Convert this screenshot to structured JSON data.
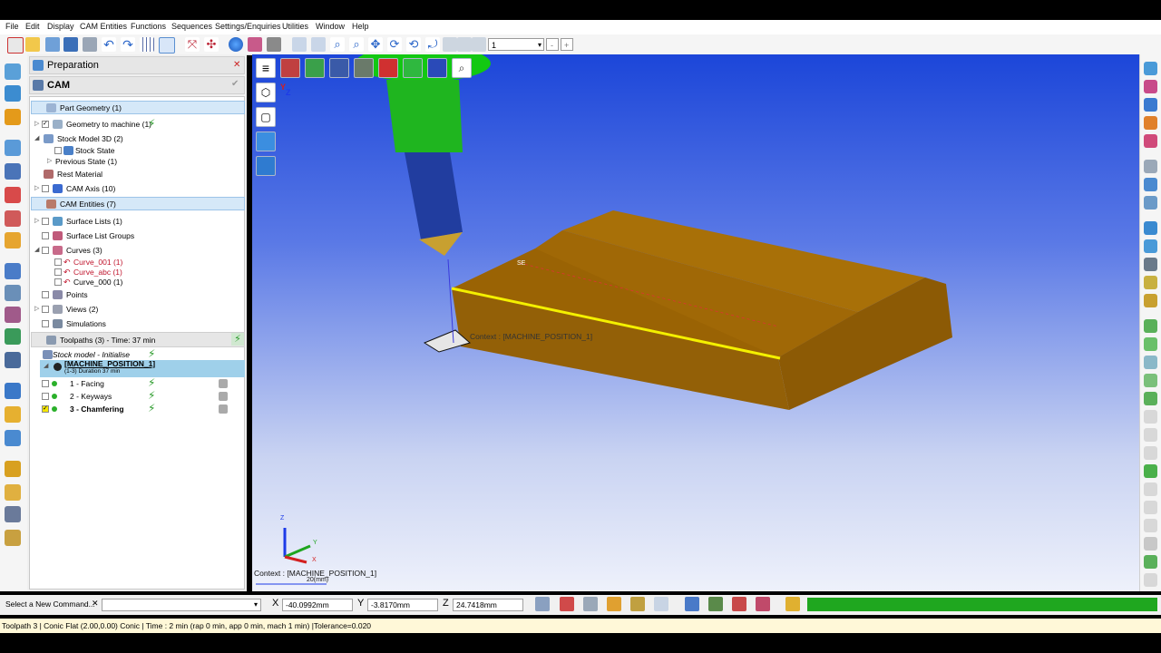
{
  "menu": [
    "File",
    "Edit",
    "Display",
    "CAM Entities",
    "Functions",
    "Sequences",
    "Settings/Enquiries",
    "Utilities",
    "Window",
    "Help"
  ],
  "toolbar": {
    "layer_value": "1",
    "minus": "-",
    "plus": "+"
  },
  "panel": {
    "title": "Preparation",
    "close": "✕",
    "section": "CAM",
    "tree": {
      "part_geometry": "Part Geometry (1)",
      "geometry_to_machine": "Geometry to machine (1)",
      "stock_model": "Stock Model 3D (2)",
      "stock_state": "Stock State",
      "previous_state": "Previous State (1)",
      "rest_material": "Rest Material",
      "cam_axis": "CAM Axis (10)",
      "cam_entities": "CAM Entities (7)",
      "surface_lists": "Surface Lists (1)",
      "surface_list_groups": "Surface List Groups",
      "curves": "Curves (3)",
      "curve_001": "Curve_001 (1)",
      "curve_abc": "Curve_abc (1)",
      "curve_000": "Curve_000 (1)",
      "points": "Points",
      "views": "Views (2)",
      "simulations": "Simulations"
    },
    "toolpaths": {
      "header": "Toolpaths (3) - Time: 37 min",
      "stock_init": "Stock model - Initialise",
      "machine_position": "[MACHINE_POSITION_1]",
      "machine_sub": "(1-3) Duration 37 min",
      "items": [
        "1 - Facing",
        "2 - Keyways",
        "3 - Chamfering"
      ]
    }
  },
  "viewport": {
    "context_label": "Context : [MACHINE_POSITION_1]",
    "bottom_context": "Context : [MACHINE_POSITION_1]",
    "scale": "20(mm)",
    "axis_z": "Z",
    "axis_y": "Y",
    "axis_x": "X",
    "cube_z": "Z",
    "cube_y": "Y",
    "colors": {
      "bg_top": "#1c46d9",
      "part": "#9a6304",
      "tool_green": "#1fb51f",
      "tool_blue": "#213d9f",
      "highlight": "#f4f000"
    }
  },
  "cmdbar": {
    "command_label": "Select a New Command...",
    "close": "✕",
    "x_label": "X",
    "x_value": "-40.0992mm",
    "y_label": "Y",
    "y_value": "-3.8170mm",
    "z_label": "Z",
    "z_value": "24.7418mm",
    "progress_color": "#1fa71f"
  },
  "status": "Toolpath 3 | Conic Flat (2.00,0.00) Conic | Time : 2 min (rap 0 min, app 0 min, mach 1 min) |Tolerance=0.020"
}
